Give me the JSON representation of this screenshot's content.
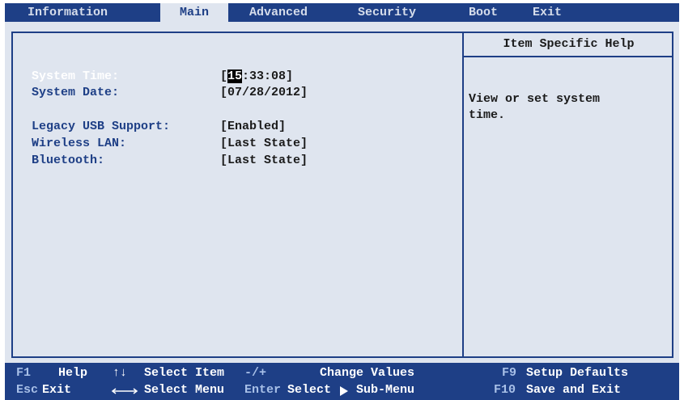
{
  "menubar": {
    "tabs": [
      {
        "label": "Information"
      },
      {
        "label": "Main"
      },
      {
        "label": "Advanced"
      },
      {
        "label": "Security"
      },
      {
        "label": "Boot"
      },
      {
        "label": "Exit"
      }
    ],
    "active_tab": "Main"
  },
  "settings": {
    "system_time": {
      "label": "System Time:",
      "value_open": "[",
      "value_selected": "15",
      "value_rest": ":33:08]"
    },
    "system_date": {
      "label": "System Date:",
      "value": "[07/28/2012]"
    },
    "legacy_usb": {
      "label": "Legacy USB Support:",
      "value": "[Enabled]"
    },
    "wireless_lan": {
      "label": "Wireless LAN:",
      "value": "[Last State]"
    },
    "bluetooth": {
      "label": "Bluetooth:",
      "value": "[Last State]"
    }
  },
  "help": {
    "title": "Item Specific Help",
    "text": "View or set system\ntime."
  },
  "footer": {
    "f1_key": "F1",
    "f1_desc": "Help",
    "updown_desc": "Select Item",
    "change_key": "-/+",
    "change_desc": "Change Values",
    "f9_key": "F9",
    "f9_desc": "Setup Defaults",
    "esc_key": "Esc",
    "esc_desc": "Exit",
    "leftright_desc": "Select Menu",
    "enter_key": "Enter",
    "enter_desc_a": "Select",
    "enter_desc_b": "Sub-Menu",
    "f10_key": "F10",
    "f10_desc": "Save and Exit"
  },
  "colors": {
    "bar_blue": "#1e3f86",
    "panel_bg": "#dfe5ef",
    "label_blue": "#1e3f86",
    "key_lightblue": "#a8c0e8",
    "selected_label": "#ffffff"
  },
  "icons": {
    "updown": "arrow-up-down-icon",
    "leftright": "arrow-left-right-icon",
    "triangle": "triangle-right-icon"
  }
}
